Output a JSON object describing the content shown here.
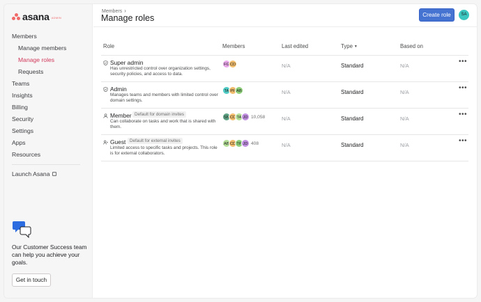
{
  "logo": {
    "word": "asana",
    "badge": "ADMIN",
    "brand_color": "#f06a6a"
  },
  "sidebar": {
    "items": [
      {
        "label": "Members",
        "level": "top",
        "active": false
      },
      {
        "label": "Manage members",
        "level": "sub",
        "active": false
      },
      {
        "label": "Manage roles",
        "level": "sub",
        "active": true
      },
      {
        "label": "Requests",
        "level": "sub",
        "active": false
      },
      {
        "label": "Teams",
        "level": "top",
        "active": false
      },
      {
        "label": "Insights",
        "level": "top",
        "active": false
      },
      {
        "label": "Billing",
        "level": "top",
        "active": false
      },
      {
        "label": "Security",
        "level": "top",
        "active": false
      },
      {
        "label": "Settings",
        "level": "top",
        "active": false
      },
      {
        "label": "Apps",
        "level": "top",
        "active": false
      },
      {
        "label": "Resources",
        "level": "top",
        "active": false
      }
    ],
    "launch_label": "Launch Asana",
    "promo_text": "Our Customer Success team can help you achieve your goals.",
    "promo_button": "Get in touch"
  },
  "header": {
    "breadcrumb": "Members",
    "title": "Manage roles",
    "create_button": "Create role",
    "user_initials": "SA",
    "accent_color": "#4573d2"
  },
  "table": {
    "columns": {
      "role": "Role",
      "members": "Members",
      "last_edited": "Last edited",
      "type": "Type",
      "based_on": "Based on"
    },
    "rows": [
      {
        "icon": "shield-icon",
        "name": "Super admin",
        "tag": "",
        "description": "Has unrestricted control over organization settings, security policies, and access to data.",
        "avatars": [
          {
            "initials": "FG",
            "color": "#e8a6e9"
          },
          {
            "initials": "CD",
            "color": "#f1bd6c"
          }
        ],
        "member_count": "",
        "last_edited": "N/A",
        "type": "Standard",
        "based_on": "N/A"
      },
      {
        "icon": "shield-icon",
        "name": "Admin",
        "tag": "",
        "description": "Manages teams and members with limited control over domain settings.",
        "avatars": [
          {
            "initials": "TA",
            "color": "#4ecbc4"
          },
          {
            "initials": "PF",
            "color": "#f1bd6c"
          },
          {
            "initials": "AB",
            "color": "#8ecf7a"
          }
        ],
        "member_count": "",
        "last_edited": "N/A",
        "type": "Standard",
        "based_on": "N/A"
      },
      {
        "icon": "person-icon",
        "name": "Member",
        "tag": "Default for domain invites",
        "description": "Can collaborate on tasks and work that is shared with them.",
        "avatars": [
          {
            "initials": "SN",
            "color": "#5da283"
          },
          {
            "initials": "CD",
            "color": "#f1bd6c"
          },
          {
            "initials": "TA",
            "color": "#b3df97"
          },
          {
            "initials": "JD",
            "color": "#c08fe0"
          }
        ],
        "member_count": "10,058",
        "last_edited": "N/A",
        "type": "Standard",
        "based_on": "N/A"
      },
      {
        "icon": "guest-icon",
        "name": "Guest",
        "tag": "Default for external invites",
        "description": "Limited access to specific tasks and projects. This role is for external collaborators.",
        "avatars": [
          {
            "initials": "AB",
            "color": "#b3df97"
          },
          {
            "initials": "CD",
            "color": "#f1bd6c"
          },
          {
            "initials": "TP",
            "color": "#8ecf7a"
          },
          {
            "initials": "JD",
            "color": "#c08fe0"
          }
        ],
        "member_count": "408",
        "last_edited": "N/A",
        "type": "Standard",
        "based_on": "N/A"
      }
    ]
  }
}
